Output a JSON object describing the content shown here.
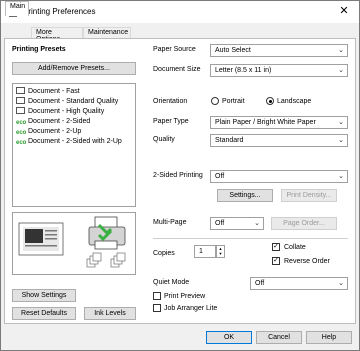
{
  "window": {
    "title": "Printing Preferences",
    "close_glyph": "✕"
  },
  "tabs": [
    {
      "label": "Main"
    },
    {
      "label": "More Options"
    },
    {
      "label": "Maintenance"
    }
  ],
  "left": {
    "presets_heading": "Printing Presets",
    "add_remove_label": "Add/Remove Presets...",
    "presets": [
      {
        "label": "Document - Fast",
        "icon": "document-icon"
      },
      {
        "label": "Document - Standard Quality",
        "icon": "document-icon"
      },
      {
        "label": "Document - High Quality",
        "icon": "document-icon"
      },
      {
        "label": "Document - 2-Sided",
        "icon": "eco-icon"
      },
      {
        "label": "Document - 2-Up",
        "icon": "eco-icon"
      },
      {
        "label": "Document - 2-Sided with 2-Up",
        "icon": "eco-icon"
      }
    ],
    "show_settings_label": "Show Settings",
    "reset_defaults_label": "Reset Defaults",
    "ink_levels_label": "Ink Levels"
  },
  "right": {
    "paper_source_label": "Paper Source",
    "paper_source_value": "Auto Select",
    "document_size_label": "Document Size",
    "document_size_value": "Letter (8.5 x 11 in)",
    "orientation_label": "Orientation",
    "portrait_label": "Portrait",
    "landscape_label": "Landscape",
    "orientation_selected": "Landscape",
    "paper_type_label": "Paper Type",
    "paper_type_value": "Plain Paper / Bright White Paper",
    "quality_label": "Quality",
    "quality_value": "Standard",
    "two_sided_label": "2-Sided Printing",
    "two_sided_value": "Off",
    "settings_label": "Settings...",
    "print_density_label": "Print Density...",
    "multi_page_label": "Multi-Page",
    "multi_page_value": "Off",
    "page_order_label": "Page Order...",
    "copies_label": "Copies",
    "copies_value": "1",
    "collate_label": "Collate",
    "collate_checked": true,
    "reverse_order_label": "Reverse Order",
    "reverse_order_checked": true,
    "quiet_mode_label": "Quiet Mode",
    "quiet_mode_value": "Off",
    "print_preview_label": "Print Preview",
    "print_preview_checked": false,
    "job_arranger_label": "Job Arranger Lite",
    "job_arranger_checked": false
  },
  "footer": {
    "ok_label": "OK",
    "cancel_label": "Cancel",
    "help_label": "Help"
  },
  "colors": {
    "accent": "#0078d7",
    "eco_green": "#2a9d2a",
    "printer_green": "#3cb043"
  }
}
